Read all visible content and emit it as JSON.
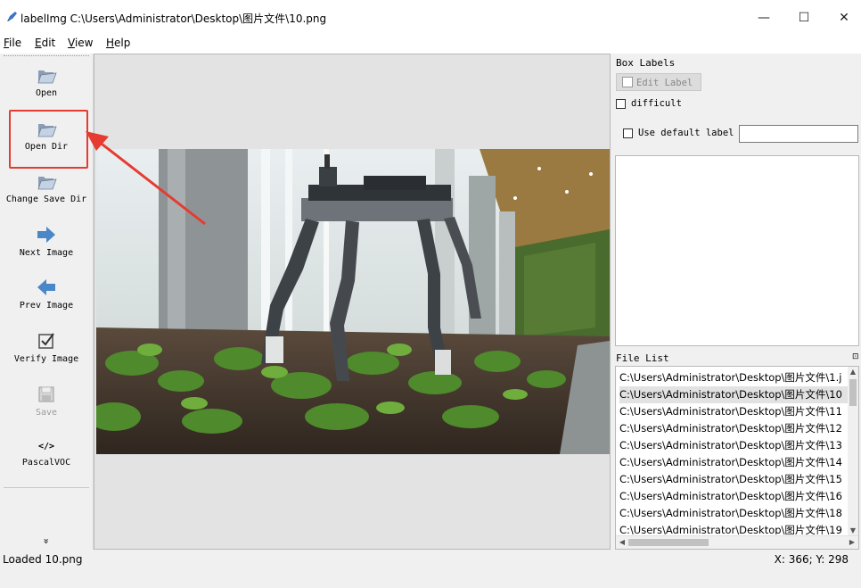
{
  "window": {
    "title": "labelImg C:\\Users\\Administrator\\Desktop\\图片文件\\10.png",
    "minimize": "—",
    "maximize": "☐",
    "close": "✕"
  },
  "menu": [
    {
      "label": "File",
      "underline": "F",
      "rest": "ile"
    },
    {
      "label": "Edit",
      "underline": "E",
      "rest": "dit"
    },
    {
      "label": "View",
      "underline": "V",
      "rest": "iew"
    },
    {
      "label": "Help",
      "underline": "H",
      "rest": "elp"
    }
  ],
  "toolbar": {
    "open": "Open",
    "open_dir": "Open Dir",
    "change_save_dir": "Change Save Dir",
    "next_image": "Next Image",
    "prev_image": "Prev Image",
    "verify_image": "Verify Image",
    "save": "Save",
    "format_icon": "</>",
    "format": "PascalVOC",
    "more": "»"
  },
  "box_labels": {
    "title": "Box Labels",
    "edit_label": "Edit Label",
    "difficult": "difficult",
    "use_default_label": "Use default label",
    "default_label_value": ""
  },
  "file_list": {
    "title": "File List",
    "selected_index": 1,
    "items": [
      "C:\\Users\\Administrator\\Desktop\\图片文件\\1.j",
      "C:\\Users\\Administrator\\Desktop\\图片文件\\10",
      "C:\\Users\\Administrator\\Desktop\\图片文件\\11",
      "C:\\Users\\Administrator\\Desktop\\图片文件\\12",
      "C:\\Users\\Administrator\\Desktop\\图片文件\\13",
      "C:\\Users\\Administrator\\Desktop\\图片文件\\14",
      "C:\\Users\\Administrator\\Desktop\\图片文件\\15",
      "C:\\Users\\Administrator\\Desktop\\图片文件\\16",
      "C:\\Users\\Administrator\\Desktop\\图片文件\\18",
      "C:\\Users\\Administrator\\Desktop\\图片文件\\19"
    ]
  },
  "status": {
    "message": "Loaded 10.png",
    "coords": "X: 366; Y: 298"
  },
  "colors": {
    "annotation": "#e53b30",
    "arrow_icon": "#4a86c8"
  }
}
